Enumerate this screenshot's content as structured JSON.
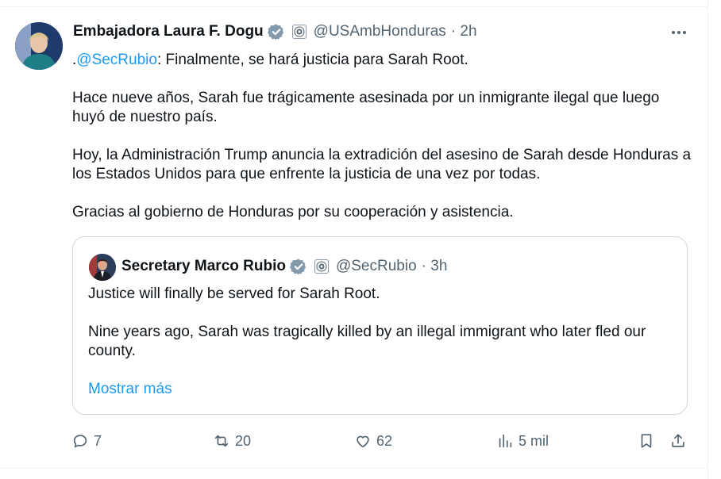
{
  "tweet": {
    "author_name": "Embajadora Laura F. Dogu",
    "handle": "@USAmbHonduras",
    "time": "· 2h",
    "mention": "@SecRubio",
    "line1_prefix": ".",
    "line1_rest": ": Finalmente, se hará justicia para Sarah Root.",
    "para2": "Hace nueve años, Sarah fue trágicamente asesinada por un inmigrante ilegal que luego huyó de nuestro país.",
    "para3": "Hoy, la Administración Trump anuncia la extradición del asesino de Sarah desde Honduras a los Estados Unidos para que enfrente la justicia de una vez por todas.",
    "para4": "Gracias al gobierno de Honduras por su cooperación y asistencia."
  },
  "quote": {
    "author_name": "Secretary Marco Rubio",
    "handle": "@SecRubio",
    "time": "· 3h",
    "para1": "Justice will finally be served for Sarah Root.",
    "para2": "Nine years ago, Sarah was tragically killed by an illegal immigrant who later fled our county.",
    "ellipsis": "...",
    "show_more": "Mostrar más"
  },
  "actions": {
    "replies": "7",
    "reposts": "20",
    "likes": "62",
    "views": "5 mil"
  },
  "icons": [
    "verified-badge-icon",
    "gov-seal-icon",
    "more-icon",
    "reply-icon",
    "repost-icon",
    "like-icon",
    "views-icon",
    "bookmark-icon",
    "share-icon"
  ],
  "colors": {
    "link": "#1d9bf0",
    "muted": "#536471",
    "verified": "#829aab",
    "border": "#cfd9de"
  }
}
